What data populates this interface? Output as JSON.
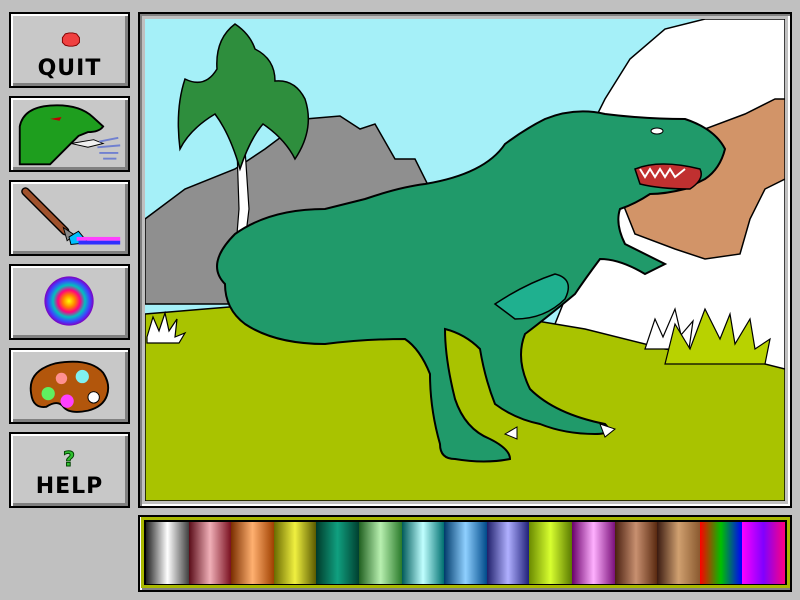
{
  "toolbar": {
    "quit_label": "QUIT",
    "help_label": "HELP",
    "buttons": [
      {
        "id": "quit",
        "icon": "stop-sign-icon"
      },
      {
        "id": "stamp",
        "icon": "dinosaur-head-icon"
      },
      {
        "id": "paint",
        "icon": "paintbrush-icon"
      },
      {
        "id": "spray",
        "icon": "rainbow-circle-icon"
      },
      {
        "id": "colors",
        "icon": "paint-palette-icon"
      },
      {
        "id": "help",
        "icon": "question-mark-icon"
      }
    ]
  },
  "colors": {
    "background": "#c0c0c0",
    "sky": "#a5f0f8",
    "grass": "#a9c300",
    "dino_body": "#209a6a",
    "dino_belly": "#1fb08f",
    "tree": "#2e8e3d",
    "mountain": "#8f8f8f",
    "rock": "#d29468",
    "palette_border": "#a9b800"
  },
  "palette": [
    [
      "#202020",
      "#ffffff",
      "#404040"
    ],
    [
      "#5a0c18",
      "#f0b0b8",
      "#7a1020"
    ],
    [
      "#7a2e00",
      "#ffb070",
      "#a04000"
    ],
    [
      "#6a6a00",
      "#f0f040",
      "#5a5a00"
    ],
    [
      "#003a2a",
      "#10a080",
      "#004030"
    ],
    [
      "#206020",
      "#b8f0b0",
      "#2a7a2a"
    ],
    [
      "#005a5a",
      "#c0ffff",
      "#007070"
    ],
    [
      "#003a6a",
      "#8fd0ff",
      "#004a8a"
    ],
    [
      "#20206a",
      "#b0b0ff",
      "#20207a"
    ],
    [
      "#6a8a00",
      "#d8ff30",
      "#5a7a00"
    ],
    [
      "#6a006a",
      "#ffb0ff",
      "#7a107a"
    ],
    [
      "#4a2010",
      "#c89070",
      "#5a2a10"
    ],
    [
      "#3a1a10",
      "#d0a070",
      "#8a5a30"
    ],
    [
      "#ff0000",
      "#00c000",
      "#0000ff"
    ],
    [
      "#ff00ff",
      "#8000ff",
      "#ff0080"
    ]
  ]
}
